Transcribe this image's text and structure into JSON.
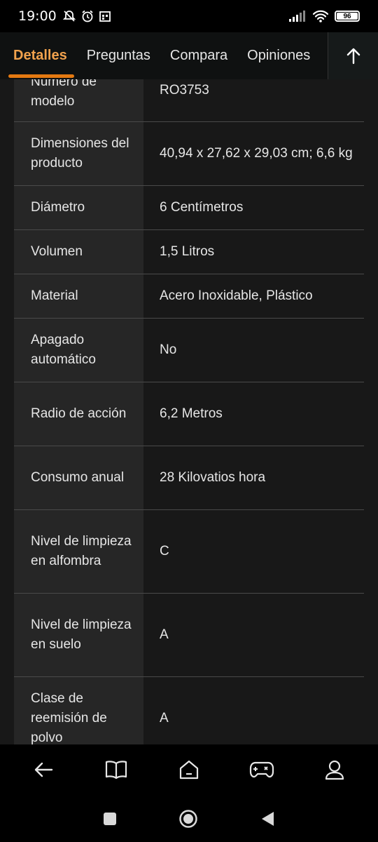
{
  "status_bar": {
    "time": "19:00",
    "battery": "96"
  },
  "tabs": [
    {
      "label": "Detalles",
      "active": true
    },
    {
      "label": "Preguntas",
      "active": false
    },
    {
      "label": "Compara",
      "active": false
    },
    {
      "label": "Opiniones",
      "active": false
    }
  ],
  "table": {
    "rows": [
      {
        "label": "Número de\nmodelo",
        "value": "RO3753"
      },
      {
        "label": "Dimensiones del producto",
        "value": "40,94 x 27,62 x 29,03 cm; 6,6 kg"
      },
      {
        "label": "Diámetro",
        "value": "6 Centímetros"
      },
      {
        "label": "Volumen",
        "value": "1,5 Litros"
      },
      {
        "label": "Material",
        "value": "Acero Inoxidable, Plástico"
      },
      {
        "label": "Apagado automático",
        "value": "No"
      },
      {
        "label": "Radio de acción",
        "value": "6,2 Metros"
      },
      {
        "label": "Consumo anual",
        "value": "28 Kilovatios hora"
      },
      {
        "label": "Nivel de limpieza en alfombra",
        "value": "C"
      },
      {
        "label": "Nivel de limpieza en suelo",
        "value": "A"
      },
      {
        "label": "Clase de reemisión de polvo",
        "value": "A"
      }
    ]
  },
  "colors": {
    "accent": "#e47911",
    "active_tab_text": "#f1a24d",
    "label_cell_bg": "#262626",
    "value_cell_bg": "#181818"
  },
  "bottom_nav": [
    "back-icon",
    "book-icon",
    "home-icon",
    "gamepad-icon",
    "profile-icon"
  ],
  "system_nav": [
    "recents-icon",
    "home-circle-icon",
    "back-triangle-icon"
  ]
}
